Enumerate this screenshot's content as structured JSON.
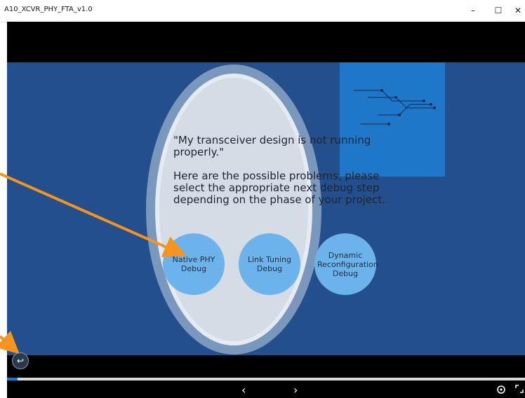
{
  "window": {
    "title": "A10_XCVR_PHY_FTA_v1.0",
    "minimize": "–",
    "maximize": "☐",
    "close": "✕"
  },
  "slide": {
    "message": "\"My transceiver design is not running properly.\"\n\nHere are the possible problems, please select the appropriate next debug step depending on the phase of your project.",
    "options": [
      {
        "label": "Native PHY Debug"
      },
      {
        "label": "Link Tuning Debug"
      },
      {
        "label": "Dynamic Reconfiguration Debug"
      }
    ]
  },
  "player": {
    "prev": "‹",
    "next": "›",
    "progress_fraction": 0.02
  },
  "colors": {
    "slide_bg": "#234f8c",
    "accent_rect": "#1e77c9",
    "bubble": "#6bb3ea",
    "arrow": "#f7941d"
  },
  "icons": [
    "back-icon",
    "settings-icon",
    "fullscreen-icon"
  ]
}
